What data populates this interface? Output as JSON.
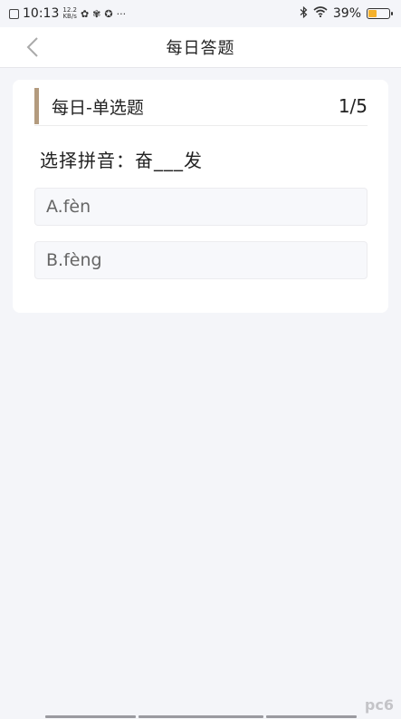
{
  "status_bar": {
    "time": "10:13",
    "net_speed_value": "12.2",
    "net_speed_unit": "KB/s",
    "battery_percent": "39%",
    "battery_level": 0.39,
    "icons": [
      "notification-icon",
      "wechat-icon",
      "app-icon",
      "app-icon",
      "more-icon",
      "bluetooth-icon",
      "wifi-icon",
      "battery-icon"
    ]
  },
  "header": {
    "title": "每日答题",
    "back_icon": "chevron-left-icon"
  },
  "question": {
    "type_label": "每日-单选题",
    "progress": "1/5",
    "text": "选择拼音：奋___发",
    "options": [
      {
        "label": "A.fèn"
      },
      {
        "label": "B.fèng"
      }
    ]
  },
  "watermark": "pc6",
  "colors": {
    "accent_bar": "#b39b7e",
    "background": "#f4f5f9",
    "card": "#ffffff",
    "battery_fill": "#f5b12b"
  }
}
